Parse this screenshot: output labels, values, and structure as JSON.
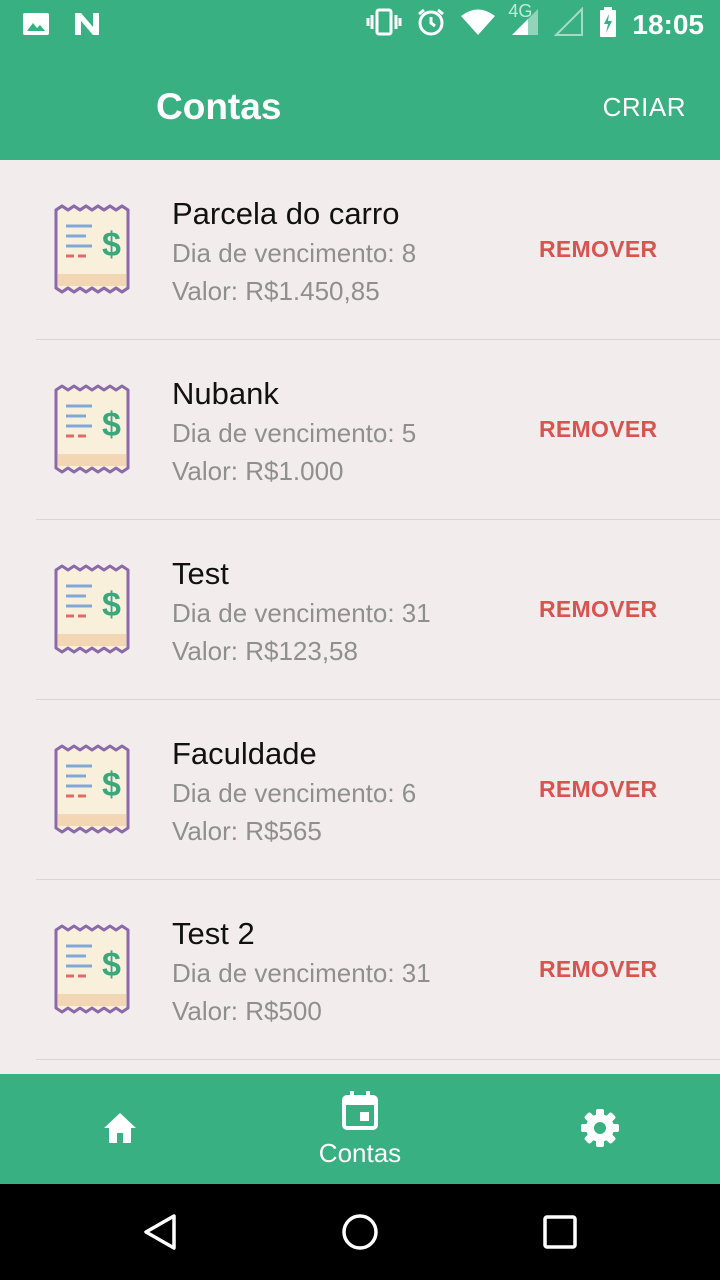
{
  "status_bar": {
    "network_label": "4G",
    "time": "18:05",
    "icons": [
      "image-icon",
      "n-icon",
      "vibrate-icon",
      "alarm-icon",
      "wifi-icon",
      "signal-icon",
      "signal-empty-icon",
      "battery-charging-icon"
    ]
  },
  "app_bar": {
    "title": "Contas",
    "action_label": "CRIAR"
  },
  "accounts": [
    {
      "name": "Parcela do carro",
      "due": "Dia de vencimento: 8",
      "value": "Valor: R$1.450,85",
      "remove_label": "REMOVER"
    },
    {
      "name": "Nubank",
      "due": "Dia de vencimento: 5",
      "value": "Valor: R$1.000",
      "remove_label": "REMOVER"
    },
    {
      "name": "Test",
      "due": "Dia de vencimento: 31",
      "value": "Valor: R$123,58",
      "remove_label": "REMOVER"
    },
    {
      "name": "Faculdade",
      "due": "Dia de vencimento: 6",
      "value": "Valor: R$565",
      "remove_label": "REMOVER"
    },
    {
      "name": "Test 2",
      "due": "Dia de vencimento: 31",
      "value": "Valor: R$500",
      "remove_label": "REMOVER"
    }
  ],
  "bottom_nav": {
    "items": [
      {
        "icon": "home-icon",
        "label": ""
      },
      {
        "icon": "calendar-icon",
        "label": "Contas"
      },
      {
        "icon": "gear-icon",
        "label": ""
      }
    ],
    "active_index": 1
  },
  "colors": {
    "primary": "#39b082",
    "background": "#f3ecec",
    "remove": "#d9534f",
    "secondary_text": "#8f8f8f"
  }
}
